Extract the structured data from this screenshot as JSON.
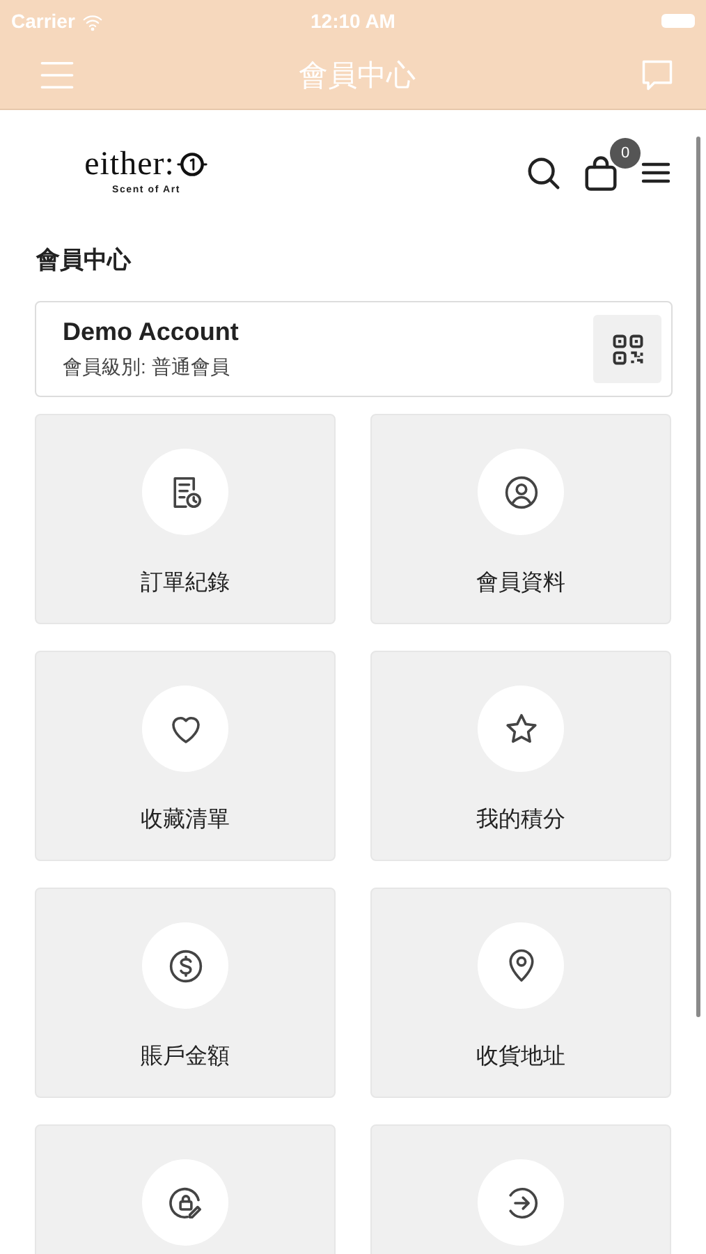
{
  "status_bar": {
    "carrier": "Carrier",
    "time": "12:10 AM"
  },
  "nav_bar": {
    "title": "會員中心"
  },
  "header": {
    "logo_text": "either:",
    "logo_tagline": "Scent of Art",
    "cart_count": "0"
  },
  "page_title": "會員中心",
  "account": {
    "name": "Demo Account",
    "level": "會員級別: 普通會員"
  },
  "tiles": [
    {
      "kind": "orders",
      "label": "訂單紀錄"
    },
    {
      "kind": "profile",
      "label": "會員資料"
    },
    {
      "kind": "wishlist",
      "label": "收藏清單"
    },
    {
      "kind": "points",
      "label": "我的積分"
    },
    {
      "kind": "balance",
      "label": "賬戶金額"
    },
    {
      "kind": "address",
      "label": "收貨地址"
    },
    {
      "kind": "password"
    },
    {
      "kind": "logout"
    }
  ]
}
